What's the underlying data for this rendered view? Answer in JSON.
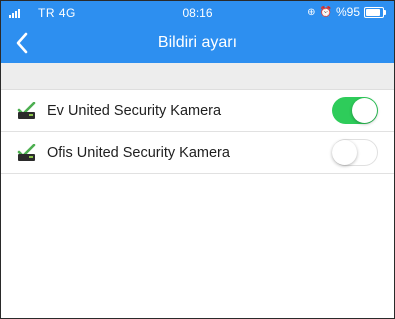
{
  "status_bar": {
    "carrier": "TR  4G",
    "time": "08:16",
    "battery_text": "%95"
  },
  "nav": {
    "title": "Bildiri ayarı",
    "back_icon": "chevron-left-icon"
  },
  "devices": [
    {
      "name": "Ev United Security Kamera",
      "notifications_enabled": true
    },
    {
      "name": "Ofis United Security Kamera",
      "notifications_enabled": false
    }
  ],
  "colors": {
    "header": "#2d8ff0",
    "toggle_on": "#2ecc5a",
    "device_icon": "#4caf50"
  }
}
